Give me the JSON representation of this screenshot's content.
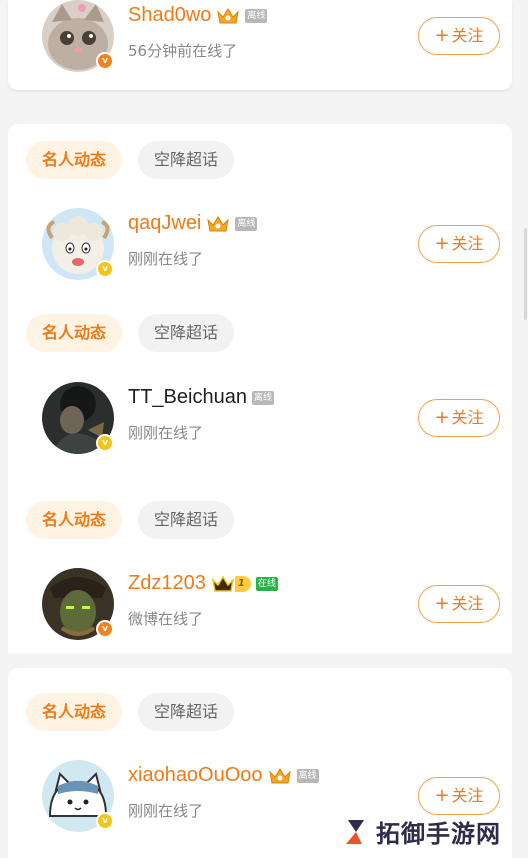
{
  "tags": {
    "hot": "名人动态",
    "plain": "空降超话"
  },
  "follow": {
    "plus": "+",
    "label": "关注"
  },
  "users": [
    {
      "name": "Shad0wo",
      "status_tag": "离线",
      "subtitle": "56分钟前在线了",
      "badge": "crown",
      "vbadge": "orange"
    },
    {
      "name": "qaqJwei",
      "status_tag": "离线",
      "subtitle": "刚刚在线了",
      "badge": "crown",
      "vbadge": "gold"
    },
    {
      "name": "TT_Beichuan",
      "status_tag": "离线",
      "subtitle": "刚刚在线了",
      "badge": "none",
      "vbadge": "gold"
    },
    {
      "name": "Zdz1203",
      "status_tag": "在线",
      "subtitle": "微博在线了",
      "badge": "level",
      "level": "1",
      "vbadge": "orange"
    },
    {
      "name": "xiaohaoOuOoo",
      "status_tag": "离线",
      "subtitle": "刚刚在线了",
      "badge": "crown",
      "vbadge": "gold"
    }
  ],
  "watermark": {
    "text": "拓御手游网"
  },
  "colors": {
    "accent": "#f07a18",
    "tag_bg": "#fff3e3",
    "online": "#2bb34a",
    "offline": "#b8b8b8"
  }
}
